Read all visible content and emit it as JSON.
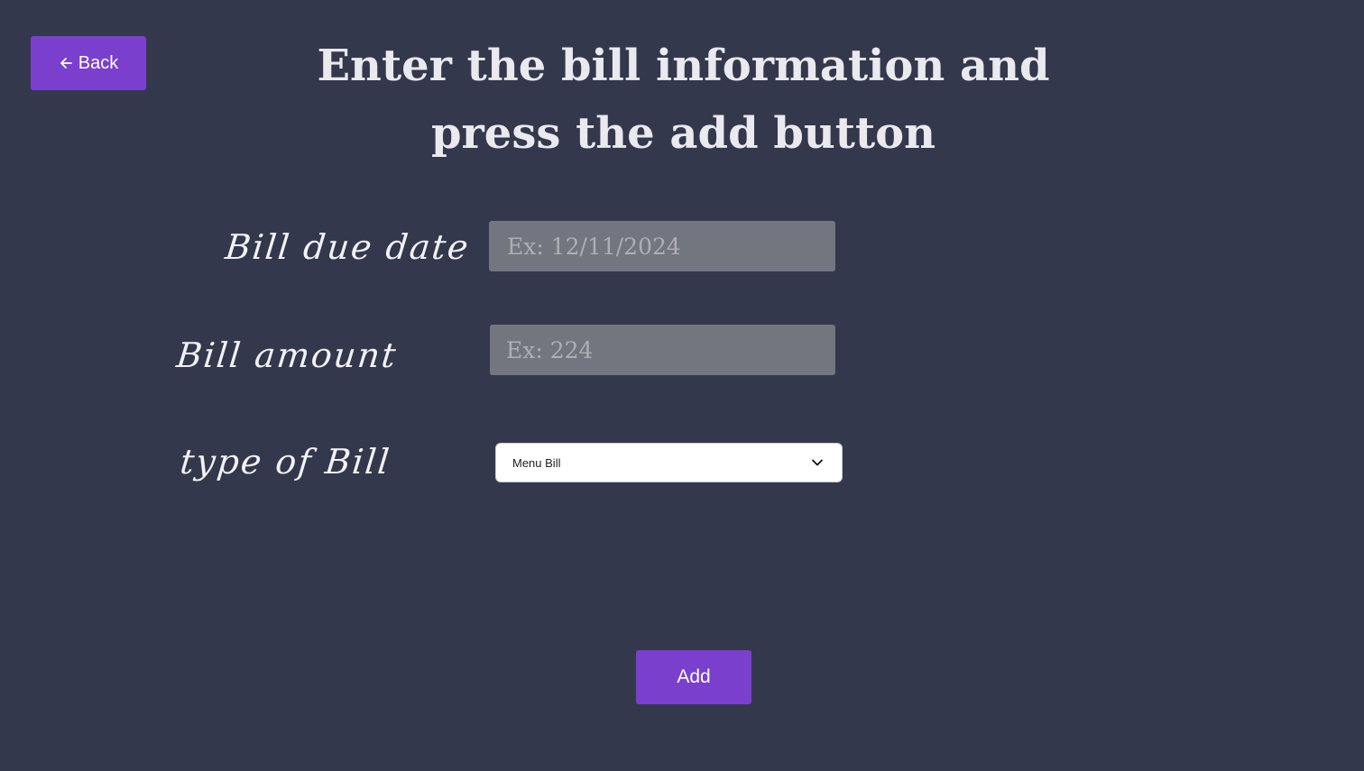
{
  "header": {
    "back_label": "Back",
    "title": "Enter the bill information and press the add button"
  },
  "form": {
    "due_date": {
      "label": "Bill due date",
      "placeholder": "Ex: 12/11/2024"
    },
    "amount": {
      "label": "Bill amount",
      "placeholder": "Ex: 224"
    },
    "type": {
      "label": "type of Bill",
      "selected": "Menu Bill"
    },
    "add_label": "Add"
  },
  "icons": {
    "back": "arrow-left-icon",
    "dropdown": "chevron-down-icon"
  },
  "colors": {
    "background": "#33384d",
    "accent": "#7b3fce",
    "input_background": "#73767f"
  }
}
